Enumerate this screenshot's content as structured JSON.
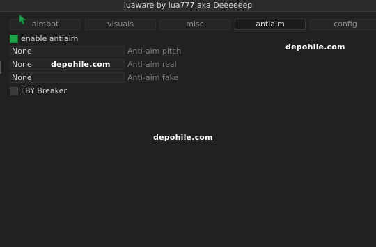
{
  "window": {
    "title": "luaware by lua777 aka Deeeeeep"
  },
  "tabs": [
    {
      "label": "aimbot",
      "active": false
    },
    {
      "label": "visuals",
      "active": false
    },
    {
      "label": "misc",
      "active": false
    },
    {
      "label": "antiaim",
      "active": true
    },
    {
      "label": "config",
      "active": false
    }
  ],
  "antiaim": {
    "enable": {
      "label": "enable antiaim",
      "checked": true
    },
    "pitch": {
      "value": "None",
      "label": "Anti-aim pitch"
    },
    "real": {
      "value": "None",
      "label": "Anti-aim real"
    },
    "fake": {
      "value": "None",
      "label": "Anti-aim fake"
    },
    "lby": {
      "label": "LBY Breaker",
      "checked": false
    }
  },
  "watermarks": [
    "depohile.com",
    "depohile.com",
    "depohile.com"
  ],
  "colors": {
    "accent_green": "#1fa34a",
    "background": "#212121",
    "cursor_green": "#1fa34a"
  },
  "icons": {
    "cursor": "mouse-pointer-icon"
  }
}
